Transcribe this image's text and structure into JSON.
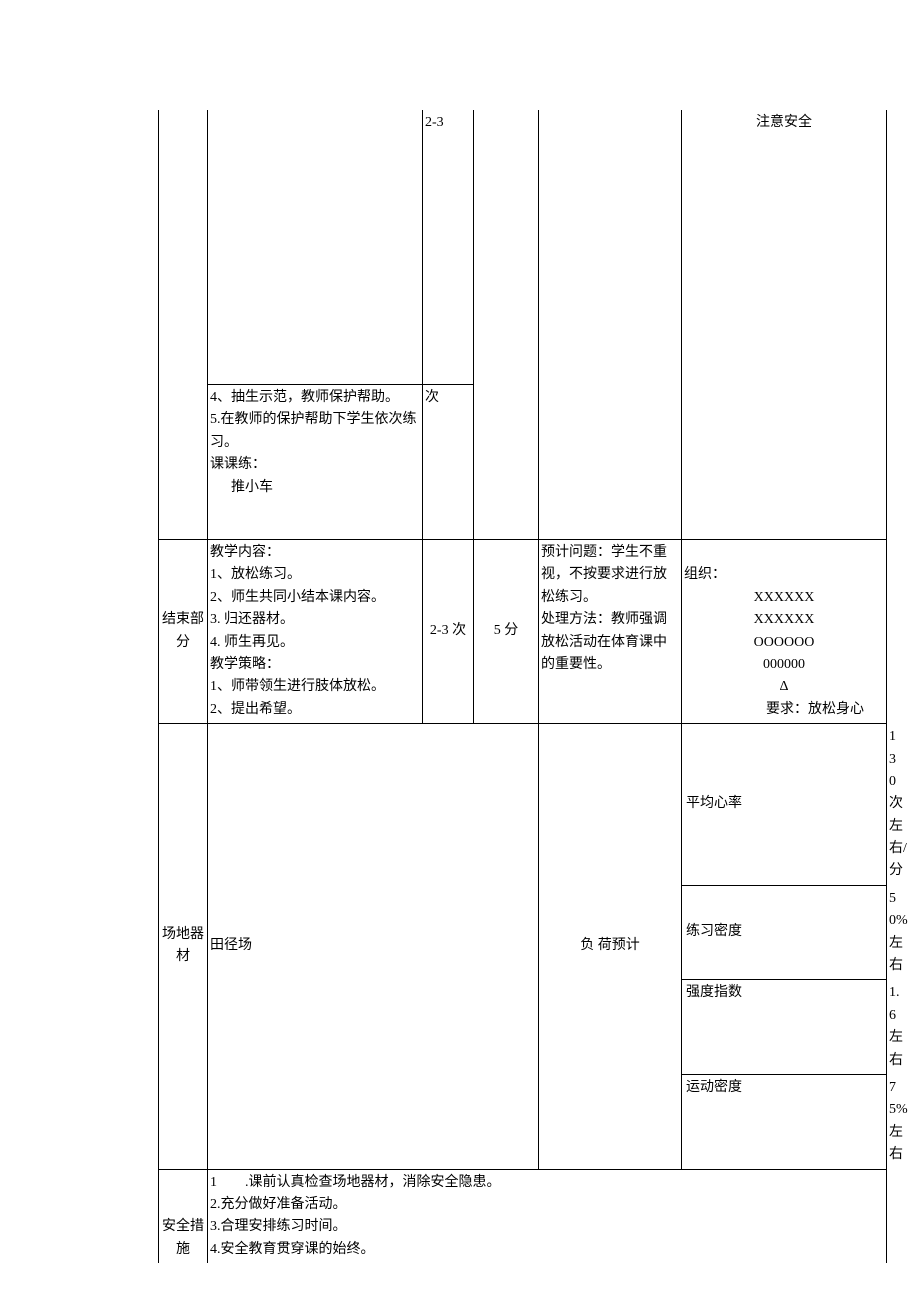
{
  "row1": {
    "times": "2-3",
    "org_note": "注意安全"
  },
  "row2": {
    "content_4": "4、抽生示范，教师保护帮助。",
    "content_5": "5.在教师的保护帮助下学生依次练习。",
    "content_kk": "课课练：",
    "content_push": "推小车",
    "times": "次"
  },
  "row3": {
    "label": "结束部分",
    "c_title": "教学内容：",
    "c1": "1、放松练习。",
    "c2": "2、师生共同小结本课内容。",
    "c3": "3. 归还器材。",
    "c4": "4. 师生再见。",
    "s_title": "教学策略：",
    "s1": "1、师带领生进行肢体放松。",
    "s2": "2、提出希望。",
    "times": "2-3 次",
    "mins": "5 分",
    "issue1": "预计问题：学生不重视，不按要求进行放松练习。",
    "issue2": "处理方法：教师强调放松活动在体育课中的重要性。",
    "org_t": "组织：",
    "org_x1": "XXXXXX",
    "org_x2": "XXXXXX",
    "org_o1": "OOOOOO",
    "org_o2": "000000",
    "org_tri": "Δ",
    "org_req": "要求：放松身心"
  },
  "row4": {
    "label": "场地器材",
    "content": "田径场",
    "load_label": "负 荷预计",
    "m1_l": "平均心率",
    "m1_v": "130 次左右/分",
    "m2_l": "练习密度",
    "m2_v": "50%左右",
    "m3_l": "强度指数",
    "m3_v": "1.6 左右",
    "m4_l": "运动密度",
    "m4_v": "75%左右"
  },
  "row5": {
    "label": "安全措施",
    "num1": "1",
    "l1": ".课前认真检查场地器材，消除安全隐患。",
    "l2": "2.充分做好准备活动。",
    "l3": "3.合理安排练习时间。",
    "l4": "4.安全教育贯穿课的始终。"
  }
}
